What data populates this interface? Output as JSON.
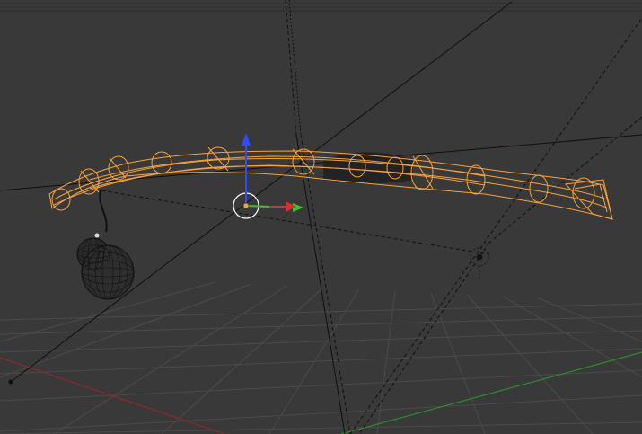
{
  "app": {
    "name": "",
    "view": "3d-viewport",
    "shading_mode": "wireframe"
  },
  "colors": {
    "background": "#393939",
    "grid_line": "#4a4a4a",
    "x_axis": "#8a2a2a",
    "y_axis": "#2f8a2f",
    "selected_wire": "#f7a23b",
    "unselected_wire": "#000000",
    "camera_lines": "#0f0f0f",
    "gizmo_x": "#d83030",
    "gizmo_y": "#36c636",
    "gizmo_z": "#2c4cff",
    "gizmo_center": "#f0a040"
  },
  "scene": {
    "objects": [
      {
        "name": "",
        "kind": "bamboo-pole",
        "selected": true
      },
      {
        "name": "",
        "kind": "gourd",
        "selected": false
      },
      {
        "name": "",
        "kind": "lamp",
        "selected": false
      },
      {
        "name": "",
        "kind": "camera",
        "selected": false
      }
    ],
    "transform_gizmo": {
      "mode": "translate",
      "axes": [
        "x",
        "y",
        "z"
      ]
    }
  }
}
